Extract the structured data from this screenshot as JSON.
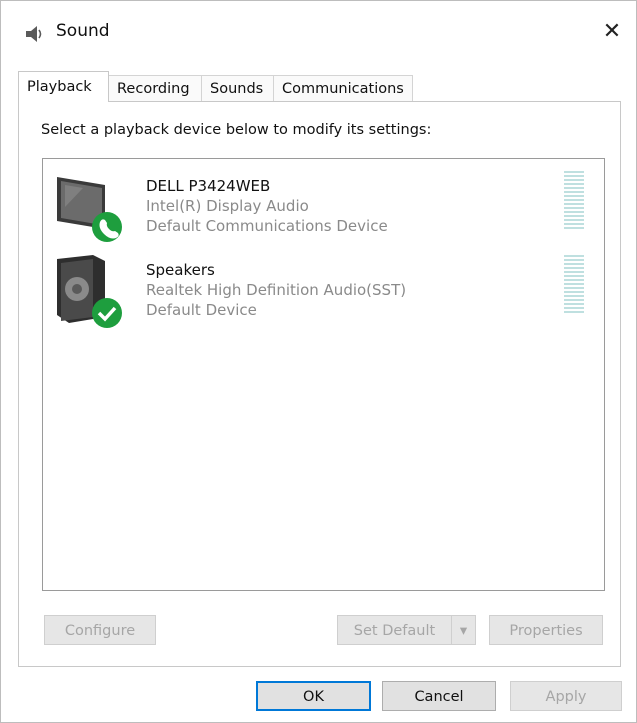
{
  "window": {
    "title": "Sound",
    "close_label": "✕"
  },
  "tabs": [
    {
      "label": "Playback"
    },
    {
      "label": "Recording"
    },
    {
      "label": "Sounds"
    },
    {
      "label": "Communications"
    }
  ],
  "panel": {
    "instruction": "Select a playback device below to modify its settings:"
  },
  "devices": [
    {
      "name": "DELL P3424WEB",
      "driver": "Intel(R) Display Audio",
      "status": "Default Communications Device",
      "icon": "monitor-icon",
      "badge": "phone-badge-icon"
    },
    {
      "name": "Speakers",
      "driver": "Realtek High Definition Audio(SST)",
      "status": "Default Device",
      "icon": "speaker-icon",
      "badge": "checkmark-badge-icon"
    }
  ],
  "buttons": {
    "configure": "Configure",
    "set_default": "Set Default",
    "set_default_arrow": "▾",
    "properties": "Properties",
    "ok": "OK",
    "cancel": "Cancel",
    "apply": "Apply"
  },
  "colors": {
    "badge_green": "#1e9e3e",
    "focus_blue": "#0078d7",
    "meter": "#bfe0e0"
  }
}
